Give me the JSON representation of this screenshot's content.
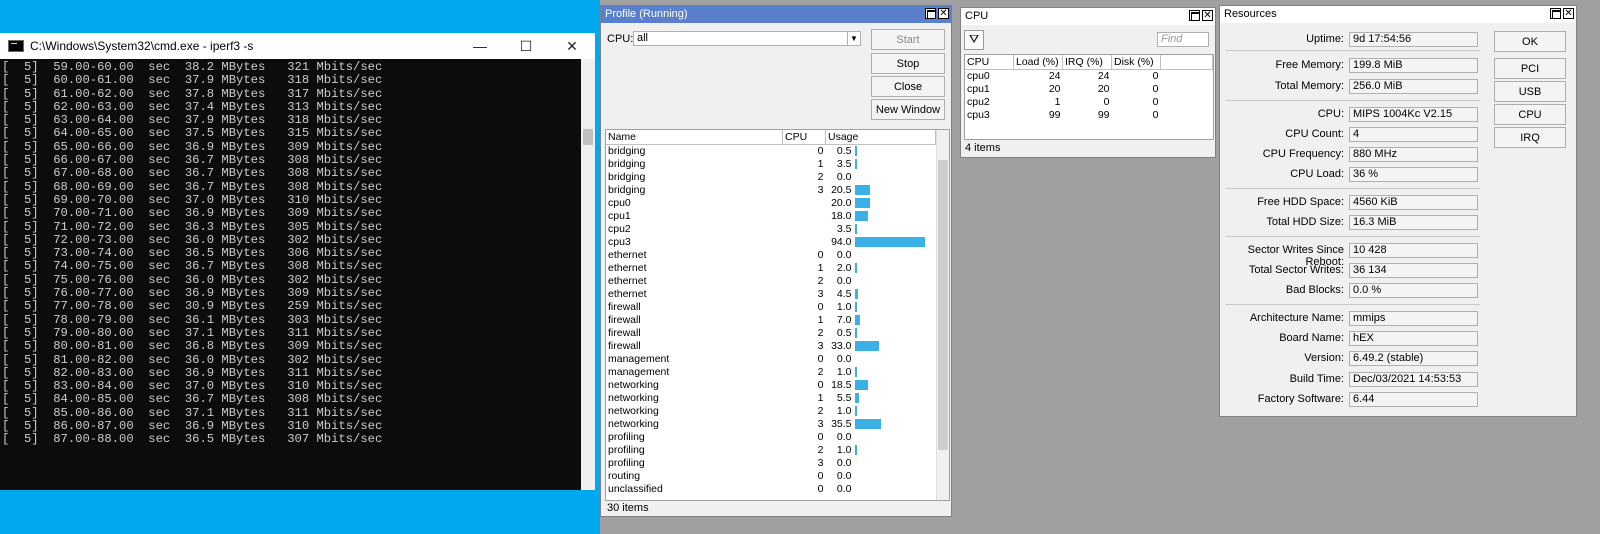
{
  "cmd": {
    "title": "C:\\Windows\\System32\\cmd.exe - iperf3  -s",
    "lines": [
      "[  5]  59.00-60.00  sec  38.2 MBytes   321 Mbits/sec",
      "[  5]  60.00-61.00  sec  37.9 MBytes   318 Mbits/sec",
      "[  5]  61.00-62.00  sec  37.8 MBytes   317 Mbits/sec",
      "[  5]  62.00-63.00  sec  37.4 MBytes   313 Mbits/sec",
      "[  5]  63.00-64.00  sec  37.9 MBytes   318 Mbits/sec",
      "[  5]  64.00-65.00  sec  37.5 MBytes   315 Mbits/sec",
      "[  5]  65.00-66.00  sec  36.9 MBytes   309 Mbits/sec",
      "[  5]  66.00-67.00  sec  36.7 MBytes   308 Mbits/sec",
      "[  5]  67.00-68.00  sec  36.7 MBytes   308 Mbits/sec",
      "[  5]  68.00-69.00  sec  36.7 MBytes   308 Mbits/sec",
      "[  5]  69.00-70.00  sec  37.0 MBytes   310 Mbits/sec",
      "[  5]  70.00-71.00  sec  36.9 MBytes   309 Mbits/sec",
      "[  5]  71.00-72.00  sec  36.3 MBytes   305 Mbits/sec",
      "[  5]  72.00-73.00  sec  36.0 MBytes   302 Mbits/sec",
      "[  5]  73.00-74.00  sec  36.5 MBytes   306 Mbits/sec",
      "[  5]  74.00-75.00  sec  36.7 MBytes   308 Mbits/sec",
      "[  5]  75.00-76.00  sec  36.0 MBytes   302 Mbits/sec",
      "[  5]  76.00-77.00  sec  36.9 MBytes   309 Mbits/sec",
      "[  5]  77.00-78.00  sec  30.9 MBytes   259 Mbits/sec",
      "[  5]  78.00-79.00  sec  36.1 MBytes   303 Mbits/sec",
      "[  5]  79.00-80.00  sec  37.1 MBytes   311 Mbits/sec",
      "[  5]  80.00-81.00  sec  36.8 MBytes   309 Mbits/sec",
      "[  5]  81.00-82.00  sec  36.0 MBytes   302 Mbits/sec",
      "[  5]  82.00-83.00  sec  36.9 MBytes   311 Mbits/sec",
      "[  5]  83.00-84.00  sec  37.0 MBytes   310 Mbits/sec",
      "[  5]  84.00-85.00  sec  36.7 MBytes   308 Mbits/sec",
      "[  5]  85.00-86.00  sec  37.1 MBytes   311 Mbits/sec",
      "[  5]  86.00-87.00  sec  36.9 MBytes   310 Mbits/sec",
      "[  5]  87.00-88.00  sec  36.5 MBytes   307 Mbits/sec"
    ],
    "minimize": "—",
    "maximize": "☐",
    "close": "✕"
  },
  "profile": {
    "title": "Profile (Running)",
    "cpu_label": "CPU:",
    "cpu_value": "all",
    "buttons": {
      "start": "Start",
      "stop": "Stop",
      "close": "Close",
      "new_window": "New Window"
    },
    "columns": [
      "Name",
      "CPU",
      "Usage"
    ],
    "rows": [
      {
        "name": "bridging",
        "cpu": "0",
        "usage": "0.5",
        "pct": 0.5
      },
      {
        "name": "bridging",
        "cpu": "1",
        "usage": "3.5",
        "pct": 3.5
      },
      {
        "name": "bridging",
        "cpu": "2",
        "usage": "0.0",
        "pct": 0
      },
      {
        "name": "bridging",
        "cpu": "3",
        "usage": "20.5",
        "pct": 20.5
      },
      {
        "name": "cpu0",
        "cpu": "",
        "usage": "20.0",
        "pct": 20
      },
      {
        "name": "cpu1",
        "cpu": "",
        "usage": "18.0",
        "pct": 18
      },
      {
        "name": "cpu2",
        "cpu": "",
        "usage": "3.5",
        "pct": 3.5
      },
      {
        "name": "cpu3",
        "cpu": "",
        "usage": "94.0",
        "pct": 94
      },
      {
        "name": "ethernet",
        "cpu": "0",
        "usage": "0.0",
        "pct": 0
      },
      {
        "name": "ethernet",
        "cpu": "1",
        "usage": "2.0",
        "pct": 2
      },
      {
        "name": "ethernet",
        "cpu": "2",
        "usage": "0.0",
        "pct": 0
      },
      {
        "name": "ethernet",
        "cpu": "3",
        "usage": "4.5",
        "pct": 4.5
      },
      {
        "name": "firewall",
        "cpu": "0",
        "usage": "1.0",
        "pct": 1
      },
      {
        "name": "firewall",
        "cpu": "1",
        "usage": "7.0",
        "pct": 7
      },
      {
        "name": "firewall",
        "cpu": "2",
        "usage": "0.5",
        "pct": 0.5
      },
      {
        "name": "firewall",
        "cpu": "3",
        "usage": "33.0",
        "pct": 33
      },
      {
        "name": "management",
        "cpu": "0",
        "usage": "0.0",
        "pct": 0
      },
      {
        "name": "management",
        "cpu": "2",
        "usage": "1.0",
        "pct": 1
      },
      {
        "name": "networking",
        "cpu": "0",
        "usage": "18.5",
        "pct": 18.5
      },
      {
        "name": "networking",
        "cpu": "1",
        "usage": "5.5",
        "pct": 5.5
      },
      {
        "name": "networking",
        "cpu": "2",
        "usage": "1.0",
        "pct": 1
      },
      {
        "name": "networking",
        "cpu": "3",
        "usage": "35.5",
        "pct": 35.5
      },
      {
        "name": "profiling",
        "cpu": "0",
        "usage": "0.0",
        "pct": 0
      },
      {
        "name": "profiling",
        "cpu": "2",
        "usage": "1.0",
        "pct": 1
      },
      {
        "name": "profiling",
        "cpu": "3",
        "usage": "0.0",
        "pct": 0
      },
      {
        "name": "routing",
        "cpu": "0",
        "usage": "0.0",
        "pct": 0
      },
      {
        "name": "unclassified",
        "cpu": "0",
        "usage": "0.0",
        "pct": 0
      }
    ],
    "count": "30 items",
    "bar_color": "#3ab0e6"
  },
  "cpu_window": {
    "title": "CPU",
    "find_placeholder": "Find",
    "columns": [
      "CPU",
      "Load (%)",
      "IRQ (%)",
      "Disk (%)"
    ],
    "rows": [
      {
        "cpu": "cpu0",
        "load": "24",
        "irq": "24",
        "disk": "0"
      },
      {
        "cpu": "cpu1",
        "load": "20",
        "irq": "20",
        "disk": "0"
      },
      {
        "cpu": "cpu2",
        "load": "1",
        "irq": "0",
        "disk": "0"
      },
      {
        "cpu": "cpu3",
        "load": "99",
        "irq": "99",
        "disk": "0"
      }
    ],
    "count": "4 items"
  },
  "resources": {
    "title": "Resources",
    "buttons": {
      "ok": "OK",
      "pci": "PCI",
      "usb": "USB",
      "cpu": "CPU",
      "irq": "IRQ"
    },
    "fields": [
      {
        "label": "Uptime:",
        "value": "9d 17:54:56"
      },
      {
        "label": "Free Memory:",
        "value": "199.8 MiB"
      },
      {
        "label": "Total Memory:",
        "value": "256.0 MiB"
      },
      {
        "label": "CPU:",
        "value": "MIPS 1004Kc V2.15"
      },
      {
        "label": "CPU Count:",
        "value": "4"
      },
      {
        "label": "CPU Frequency:",
        "value": "880 MHz"
      },
      {
        "label": "CPU Load:",
        "value": "36 %"
      },
      {
        "label": "Free HDD Space:",
        "value": "4560 KiB"
      },
      {
        "label": "Total HDD Size:",
        "value": "16.3 MiB"
      },
      {
        "label": "Sector Writes Since Reboot:",
        "value": "10 428"
      },
      {
        "label": "Total Sector Writes:",
        "value": "36 134"
      },
      {
        "label": "Bad Blocks:",
        "value": "0.0 %"
      },
      {
        "label": "Architecture Name:",
        "value": "mmips"
      },
      {
        "label": "Board Name:",
        "value": "hEX"
      },
      {
        "label": "Version:",
        "value": "6.49.2 (stable)"
      },
      {
        "label": "Build Time:",
        "value": "Dec/03/2021 14:53:53"
      },
      {
        "label": "Factory Software:",
        "value": "6.44"
      }
    ]
  }
}
